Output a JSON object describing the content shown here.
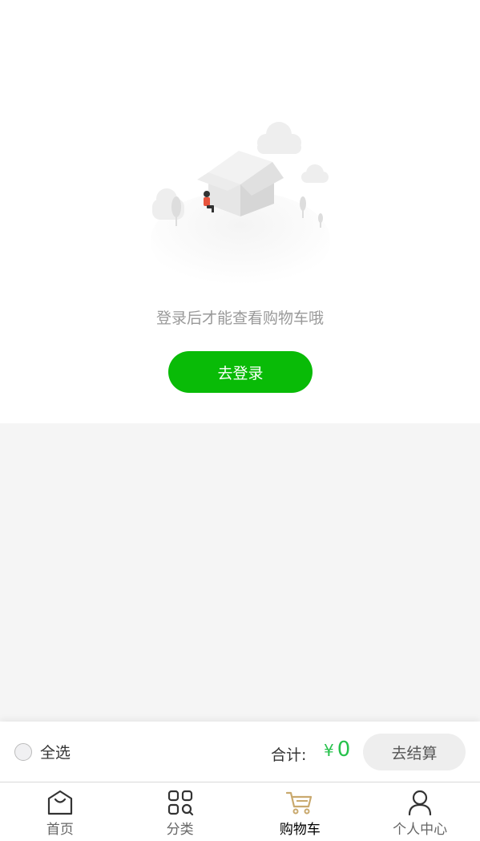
{
  "empty_state": {
    "message": "登录后才能查看购物车哦",
    "login_button_label": "去登录"
  },
  "checkout_bar": {
    "select_all_label": "全选",
    "total_label": "合计:",
    "currency_symbol": "¥",
    "total_amount": "0",
    "checkout_button_label": "去结算",
    "price_color": "#27c24c"
  },
  "tabbar": {
    "active_color": "#c9a96e",
    "items": [
      {
        "label": "首页",
        "icon": "home-icon"
      },
      {
        "label": "分类",
        "icon": "category-icon"
      },
      {
        "label": "购物车",
        "icon": "cart-icon",
        "active": true
      },
      {
        "label": "个人中心",
        "icon": "user-icon"
      }
    ]
  },
  "theme": {
    "primary_green": "#09bb07"
  }
}
